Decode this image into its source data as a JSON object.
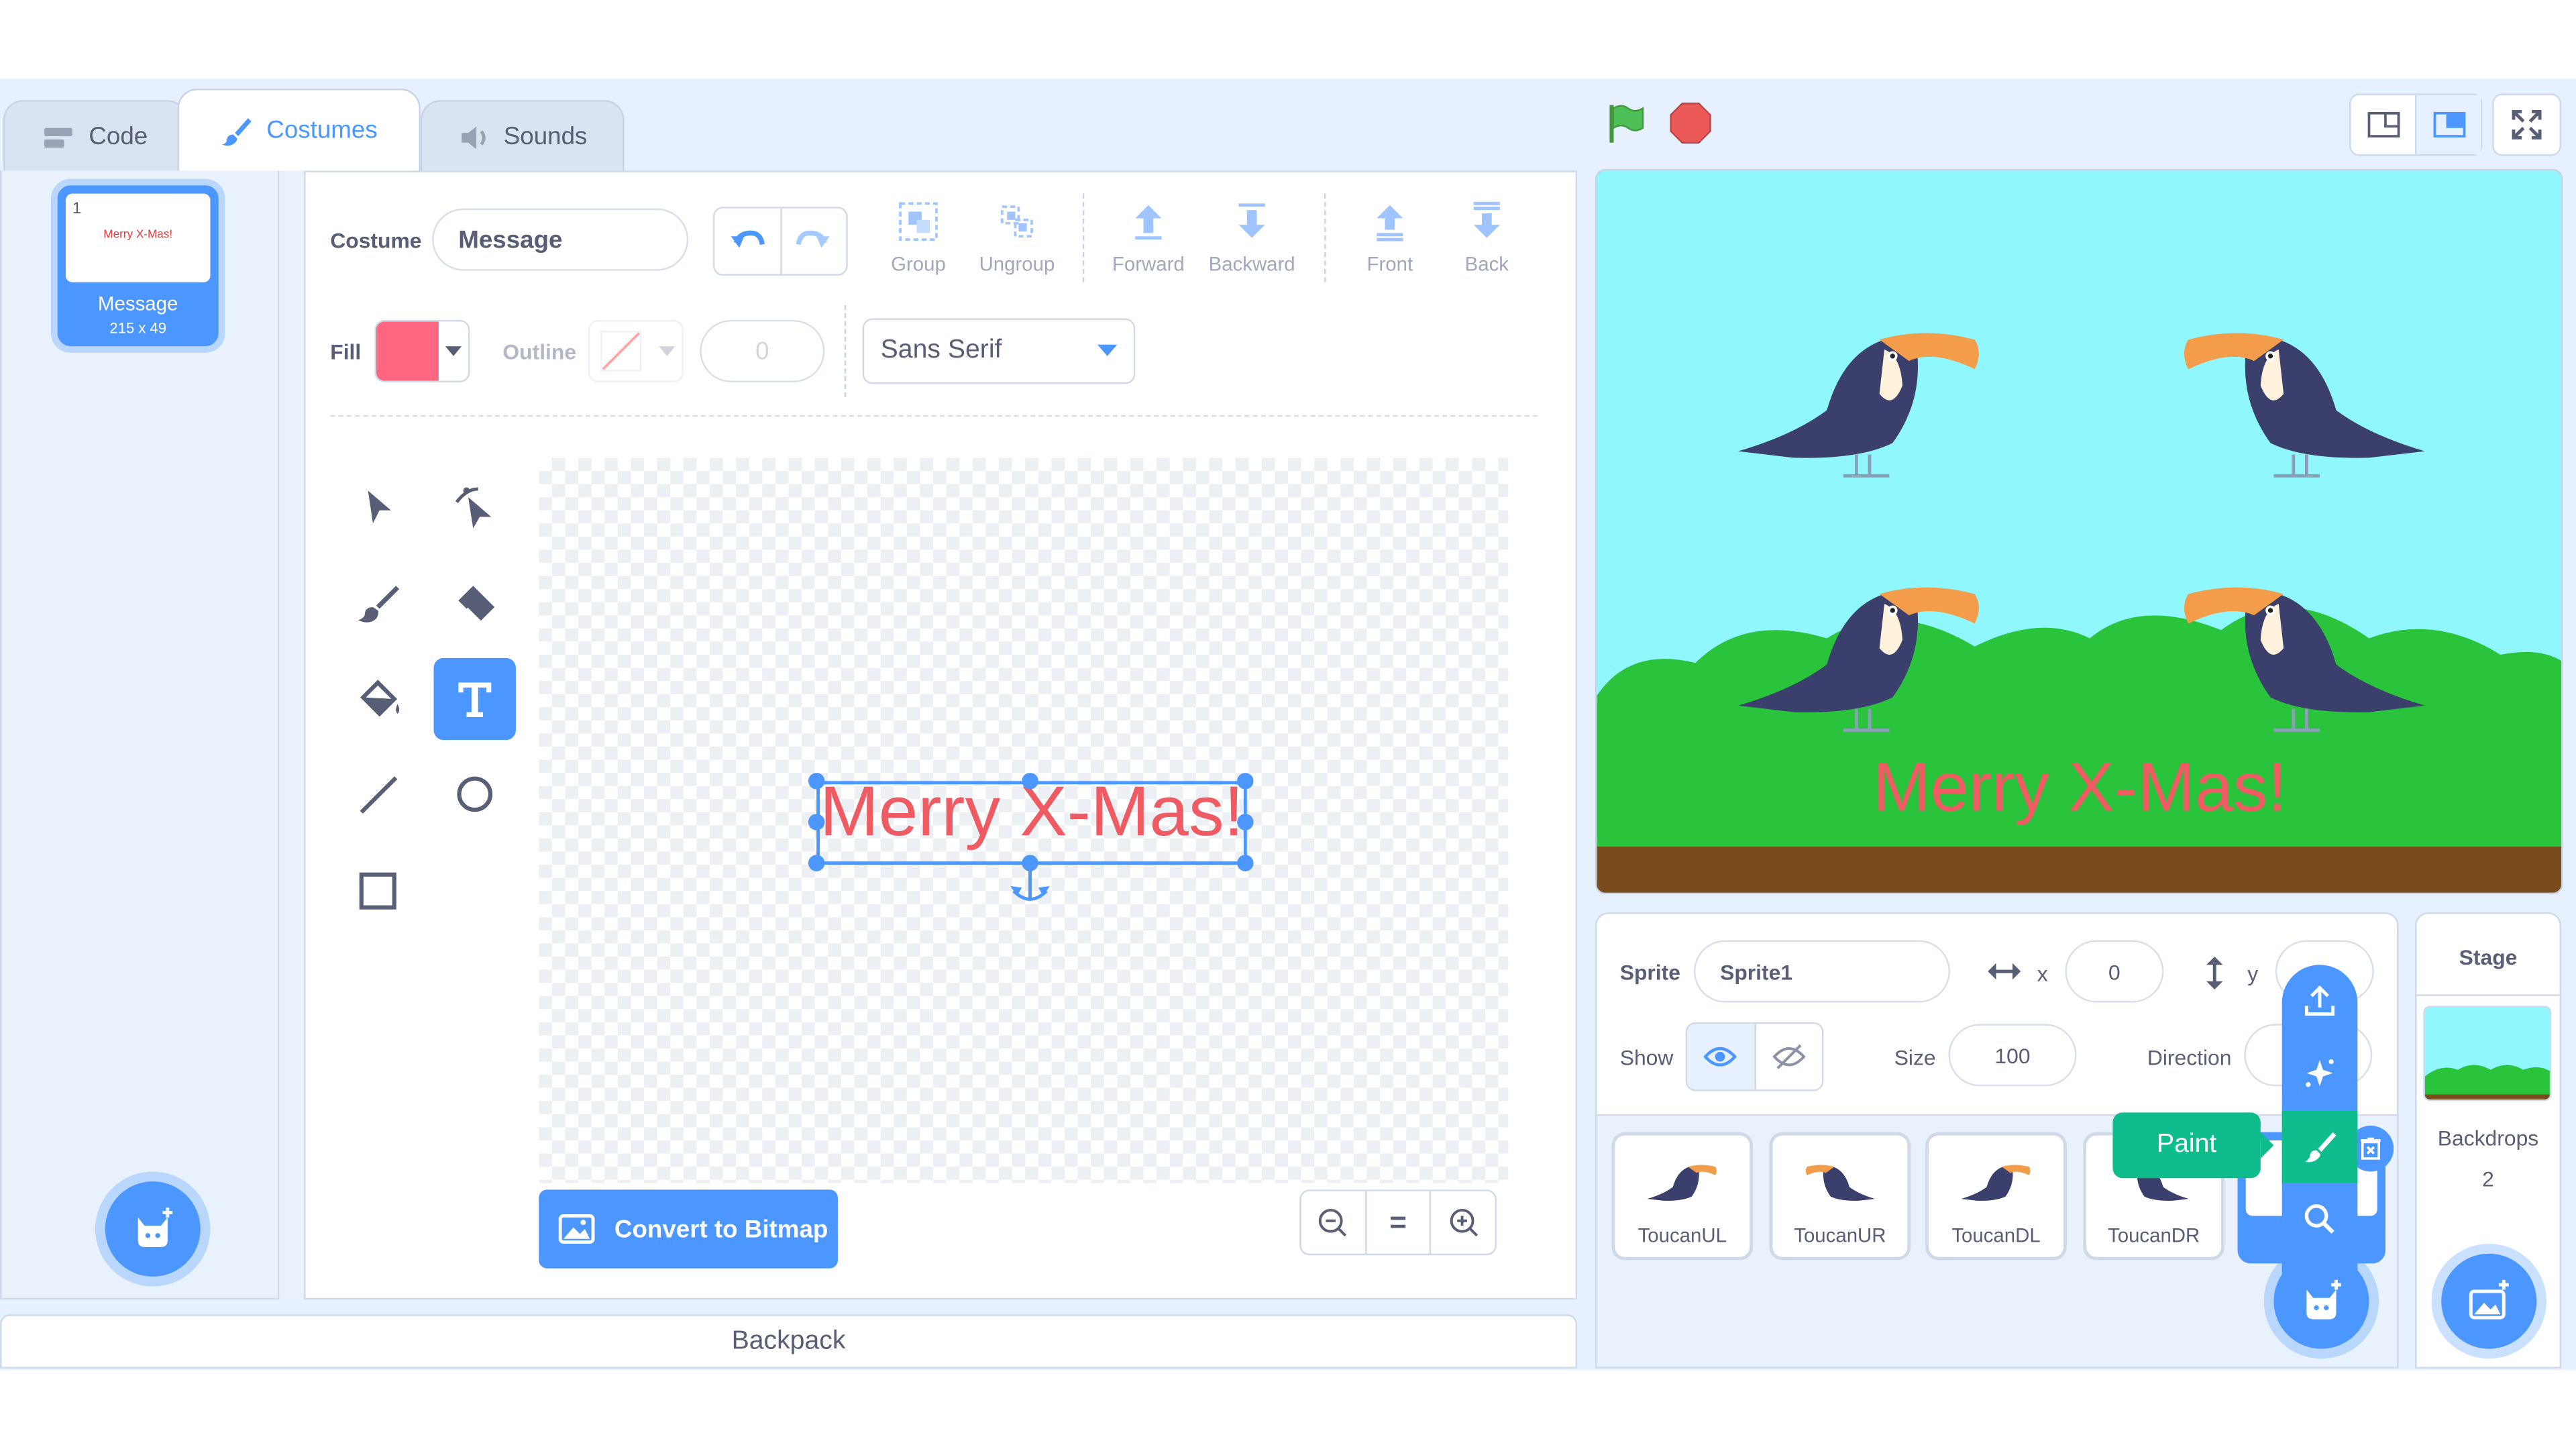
{
  "tabs": [
    {
      "label": "Code"
    },
    {
      "label": "Costumes"
    },
    {
      "label": "Sounds"
    }
  ],
  "costume_list": {
    "items": [
      {
        "number": "1",
        "name": "Message",
        "dims": "215 x 49",
        "thumb_text": "Merry X-Mas!"
      }
    ]
  },
  "editor": {
    "costume_label": "Costume",
    "costume_name": "Message",
    "fill_label": "Fill",
    "fill_color": "#ff6680",
    "outline_label": "Outline",
    "outline_width": "0",
    "font": "Sans Serif",
    "tools_top": [
      {
        "label": "Group"
      },
      {
        "label": "Ungroup"
      },
      {
        "label": "Forward"
      },
      {
        "label": "Backward"
      },
      {
        "label": "Front"
      },
      {
        "label": "Back"
      }
    ],
    "canvas_text": "Merry X-Mas!",
    "convert_button": "Convert to Bitmap",
    "zoom_reset": "="
  },
  "backpack": "Backpack",
  "stage": {
    "text": "Merry X-Mas!"
  },
  "sprite_info": {
    "sprite_label": "Sprite",
    "sprite_name": "Sprite1",
    "x_label": "x",
    "x_value": "0",
    "y_label": "y",
    "show_label": "Show",
    "size_label": "Size",
    "size_value": "100",
    "direction_label": "Direction"
  },
  "sprites": [
    {
      "name": "ToucanUL"
    },
    {
      "name": "ToucanUR"
    },
    {
      "name": "ToucanDL"
    },
    {
      "name": "ToucanDR"
    }
  ],
  "paint_tooltip": "Paint",
  "stage_panel": {
    "title": "Stage",
    "backdrops_label": "Backdrops",
    "backdrops_count": "2"
  },
  "colors": {
    "accent": "#4c97ff",
    "paint_green": "#0fbd8c",
    "text_red": "#ef5b63",
    "sky": "#91f7ff",
    "grass": "#2ac33c",
    "ground": "#7a4b1d"
  }
}
